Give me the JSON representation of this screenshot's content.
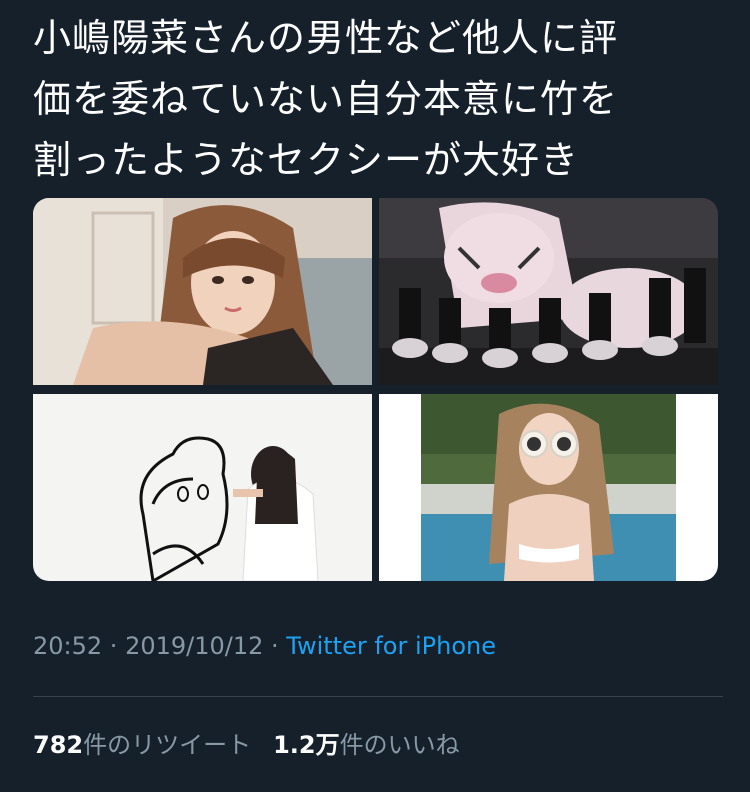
{
  "tweet": {
    "text_lines": [
      "小嶋陽菜さんの男性など他人に評",
      "価を委ねていない自分本意に竹を",
      "割ったようなセクシーが大好き"
    ]
  },
  "media": [
    {
      "name": "photo-portrait"
    },
    {
      "name": "photo-stage-performance"
    },
    {
      "name": "photo-drawing-wall"
    },
    {
      "name": "photo-poolside-sunglasses"
    }
  ],
  "meta": {
    "time": "20:52",
    "separator": " · ",
    "date": "2019/10/12",
    "source": "Twitter for iPhone"
  },
  "stats": {
    "retweet_count": "782",
    "retweet_label": "件のリツイート",
    "like_count": "1.2万",
    "like_label": "件のいいね"
  },
  "colors": {
    "background": "#15202b",
    "text": "#ffffff",
    "secondary": "#8899a6",
    "link": "#1da1f2",
    "divider": "#38444d"
  }
}
